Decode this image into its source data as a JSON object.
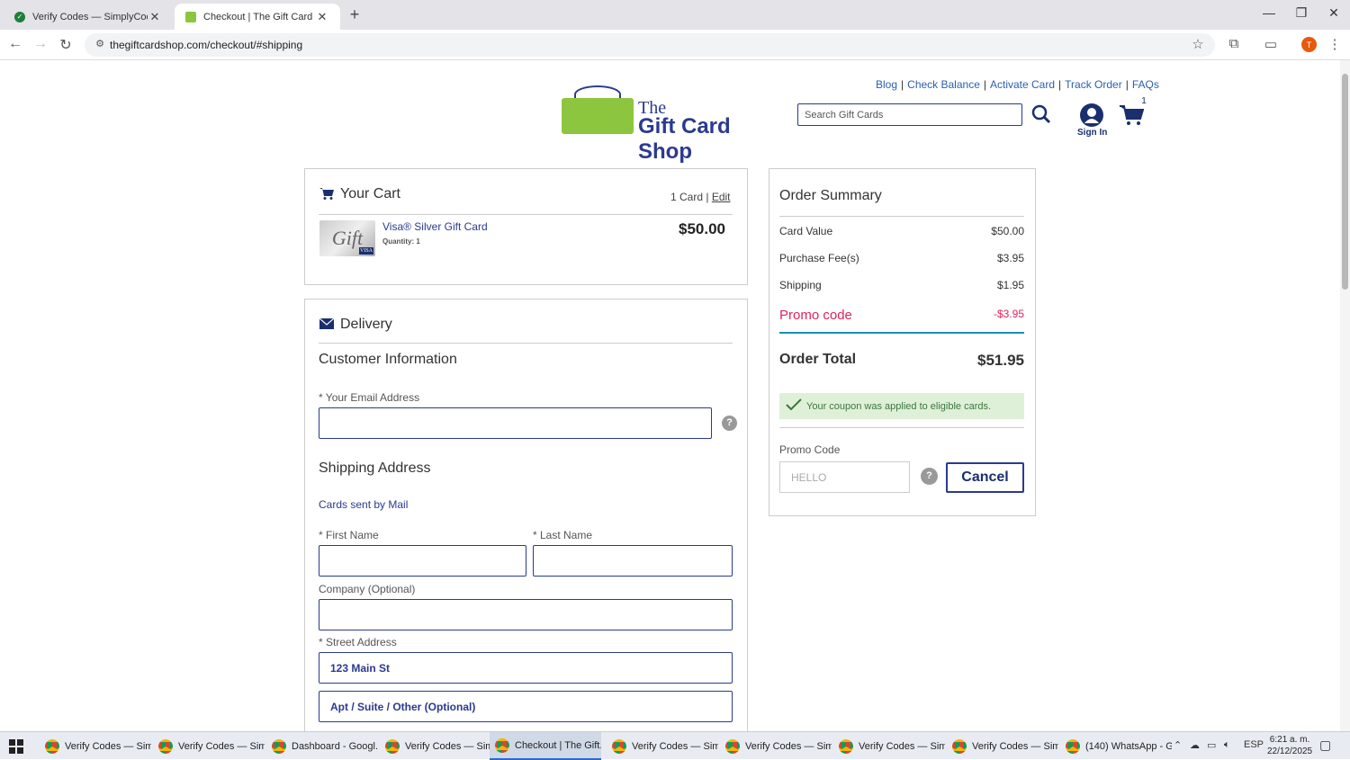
{
  "browser": {
    "tabs": [
      {
        "title": "Verify Codes — SimplyCodes",
        "active": false
      },
      {
        "title": "Checkout | The Gift Card Shop",
        "active": true
      }
    ],
    "url": "thegiftcardshop.com/checkout/#shipping"
  },
  "site": {
    "top_links": [
      "Blog",
      "Check Balance",
      "Activate Card",
      "Track Order",
      "FAQs"
    ],
    "logo_the": "The",
    "logo_name": "Gift Card Shop",
    "search_placeholder": "Search Gift Cards",
    "sign_in": "Sign In",
    "cart_count": "1"
  },
  "cart": {
    "title": "Your Cart",
    "count_label": "1 Card",
    "edit": "Edit",
    "item_name": "Visa® Silver Gift Card",
    "item_qty": "Quantity: 1",
    "item_price": "$50.00",
    "card_image_text": "Gift",
    "card_brand": "VISA"
  },
  "delivery": {
    "title": "Delivery",
    "customer_info": "Customer Information",
    "email_label": "* Your Email Address",
    "email_value": "",
    "shipping_title": "Shipping Address",
    "sent_by": "Cards sent by Mail",
    "first_name_label": "* First Name",
    "last_name_label": "* Last Name",
    "company_label": "Company (Optional)",
    "street_label": "* Street Address",
    "street_placeholder": "123 Main St",
    "apt_placeholder": "Apt / Suite / Other (Optional)"
  },
  "summary": {
    "title": "Order Summary",
    "rows": [
      {
        "label": "Card Value",
        "amount": "$50.00"
      },
      {
        "label": "Purchase Fee(s)",
        "amount": "$3.95"
      },
      {
        "label": "Shipping",
        "amount": "$1.95"
      }
    ],
    "promo_label": "Promo code",
    "promo_amount": "-$3.95",
    "total_label": "Order Total",
    "total_amount": "$51.95",
    "coupon_msg": "Your coupon was applied to eligible cards.",
    "promo_code_label": "Promo Code",
    "promo_code_value": "HELLO",
    "cancel": "Cancel",
    "promo_color": "#e0245e",
    "brand_color": "#2b3a8f"
  },
  "taskbar": {
    "items": [
      "Verify Codes — Sim...",
      "Verify Codes — Sim...",
      "Dashboard - Googl...",
      "Verify Codes — Sim...",
      "Checkout | The Gift...",
      "Verify Codes — Sim...",
      "Verify Codes — Sim...",
      "Verify Codes — Sim...",
      "Verify Codes — Sim...",
      "(140) WhatsApp - G..."
    ],
    "lang": "ESP",
    "time": "6:21 a. m.",
    "date": "22/12/2025"
  }
}
